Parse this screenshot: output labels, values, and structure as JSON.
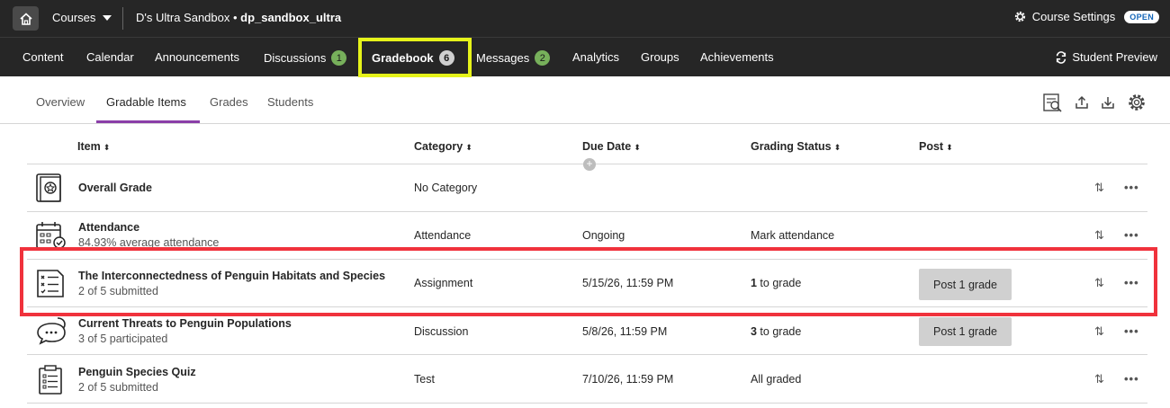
{
  "topbar": {
    "courses_label": "Courses",
    "course_prefix": "D's Ultra Sandbox",
    "course_separator": " • ",
    "course_code": "dp_sandbox_ultra",
    "course_settings_label": "Course Settings",
    "open_badge": "OPEN"
  },
  "nav": {
    "items": [
      {
        "label": "Content"
      },
      {
        "label": "Calendar"
      },
      {
        "label": "Announcements"
      },
      {
        "label": "Discussions",
        "badge": "1"
      },
      {
        "label": "Gradebook",
        "badge": "6"
      },
      {
        "label": "Messages",
        "badge": "2"
      },
      {
        "label": "Analytics"
      },
      {
        "label": "Groups"
      },
      {
        "label": "Achievements"
      }
    ],
    "student_preview": "Student Preview"
  },
  "subtabs": {
    "items": [
      {
        "label": "Overview"
      },
      {
        "label": "Gradable Items"
      },
      {
        "label": "Grades"
      },
      {
        "label": "Students"
      }
    ]
  },
  "columns": {
    "item": "Item",
    "category": "Category",
    "due_date": "Due Date",
    "grading_status": "Grading Status",
    "post": "Post",
    "sort_glyph": "⬍"
  },
  "rows": [
    {
      "title": "Overall Grade",
      "subtitle": "",
      "category": "No Category",
      "due": "",
      "status_count": "",
      "status": "",
      "post": "",
      "icon": "overall-grade-icon"
    },
    {
      "title": "Attendance",
      "subtitle": "84.93% average attendance",
      "category": "Attendance",
      "due": "Ongoing",
      "status_count": "",
      "status": "Mark attendance",
      "post": "",
      "icon": "attendance-calendar-icon"
    },
    {
      "title": "The Interconnectedness of Penguin Habitats and Species",
      "subtitle": "2 of 5 submitted",
      "category": "Assignment",
      "due": "5/15/26, 11:59 PM",
      "status_count": "1",
      "status": " to grade",
      "post": "Post 1 grade",
      "icon": "assignment-icon"
    },
    {
      "title": "Current Threats to Penguin Populations",
      "subtitle": "3 of 5 participated",
      "category": "Discussion",
      "due": "5/8/26, 11:59 PM",
      "status_count": "3",
      "status": " to grade",
      "post": "Post 1 grade",
      "icon": "discussion-icon"
    },
    {
      "title": "Penguin Species Quiz",
      "subtitle": "2 of 5 submitted",
      "category": "Test",
      "due": "7/10/26, 11:59 PM",
      "status_count": "",
      "status": "All graded",
      "post": "",
      "icon": "test-icon"
    }
  ],
  "row_actions": {
    "reorder": "⇅",
    "more": "•••"
  },
  "colors": {
    "topbar": "#262626",
    "badge": "#77b05b",
    "active_tab": "#8a3ea8",
    "nav_highlight": "#e6f31a",
    "row_highlight": "#f0323c"
  }
}
